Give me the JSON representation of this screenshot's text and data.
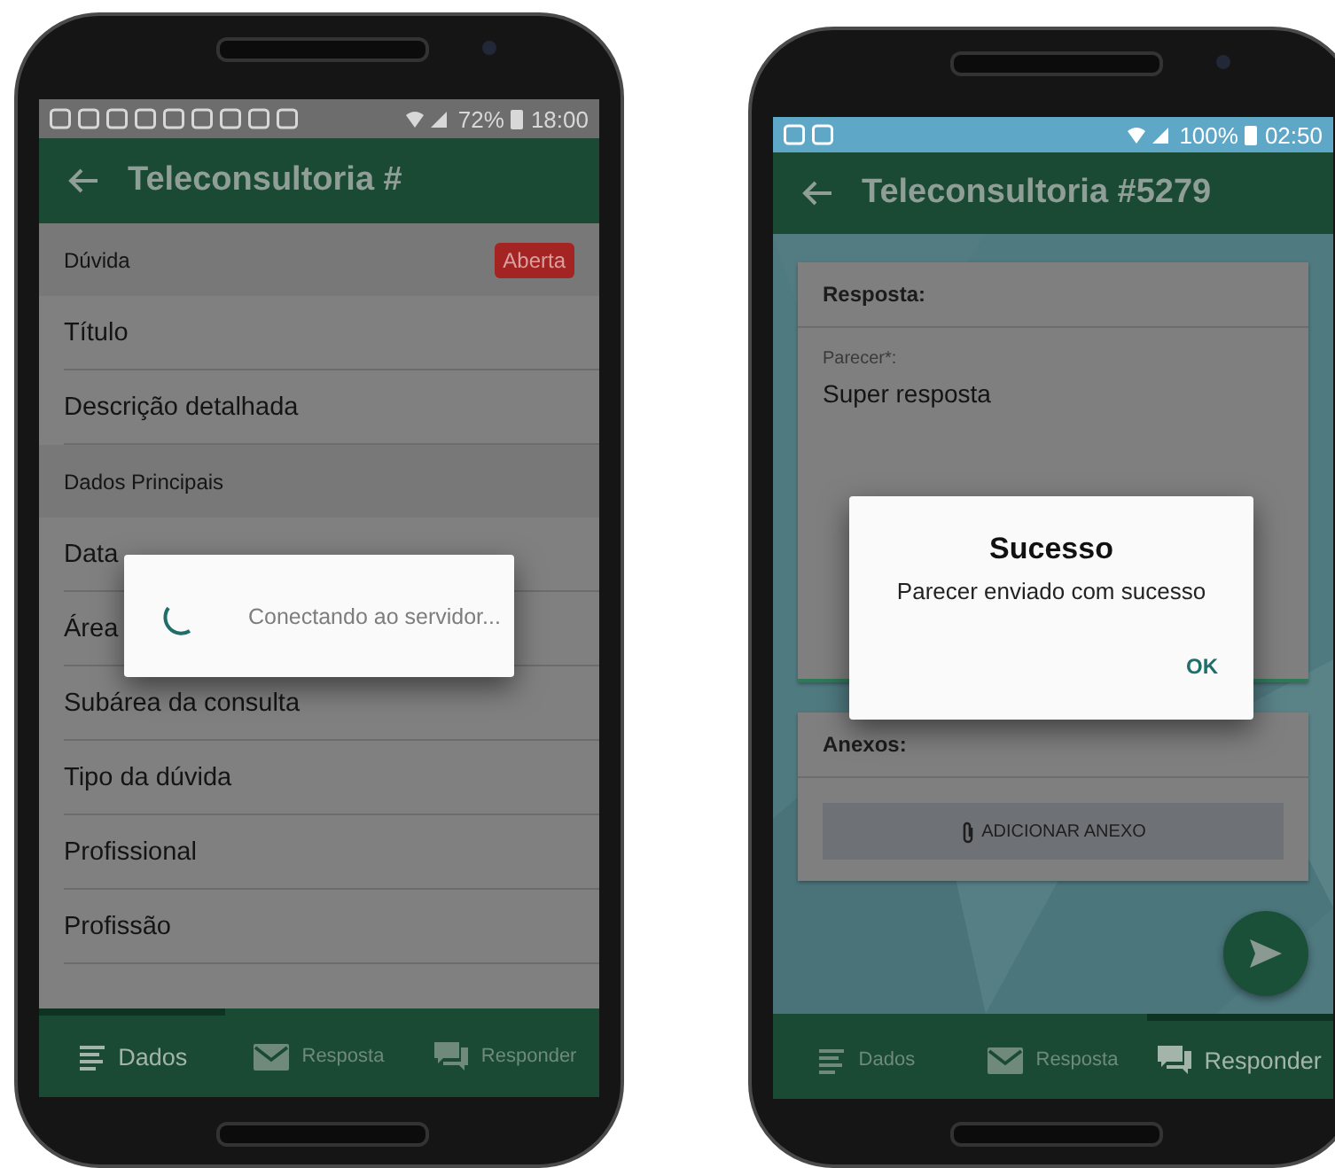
{
  "phones": [
    {
      "status_bar": {
        "battery": "72%",
        "time": "18:00"
      },
      "app_bar": {
        "title": "Teleconsultoria #"
      },
      "content": {
        "kind": "list",
        "rows": [
          {
            "kind": "section",
            "label": "Dúvida",
            "badge": "Aberta"
          },
          {
            "kind": "field",
            "label": "Título"
          },
          {
            "kind": "field",
            "label": "Descrição detalhada"
          },
          {
            "kind": "section",
            "label": "Dados Principais"
          },
          {
            "kind": "field",
            "label": "Data"
          },
          {
            "kind": "field",
            "label": "Área"
          },
          {
            "kind": "field",
            "label": "Subárea da consulta"
          },
          {
            "kind": "field",
            "label": "Tipo da dúvida"
          },
          {
            "kind": "field",
            "label": "Profissional"
          },
          {
            "kind": "field",
            "label": "Profissão"
          }
        ]
      },
      "dialog": {
        "kind": "progress",
        "message": "Conectando ao servidor..."
      },
      "tabs": [
        {
          "label": "Dados",
          "selected": true
        },
        {
          "label": "Resposta",
          "selected": false
        },
        {
          "label": "Responder",
          "selected": false
        }
      ]
    },
    {
      "status_bar": {
        "battery": "100%",
        "time": "02:50"
      },
      "app_bar": {
        "title": "Teleconsultoria #5279"
      },
      "content": {
        "kind": "form",
        "cards": [
          {
            "title": "Resposta:",
            "field": {
              "label": "Parecer*:",
              "value": "Super resposta"
            }
          },
          {
            "title": "Anexos:",
            "button": "ADICIONAR ANEXO"
          }
        ]
      },
      "dialog": {
        "kind": "alert",
        "title": "Sucesso",
        "message": "Parecer enviado com sucesso",
        "button": "OK"
      },
      "tabs": [
        {
          "label": "Dados",
          "selected": false
        },
        {
          "label": "Resposta",
          "selected": false
        },
        {
          "label": "Responder",
          "selected": true
        }
      ]
    }
  ]
}
